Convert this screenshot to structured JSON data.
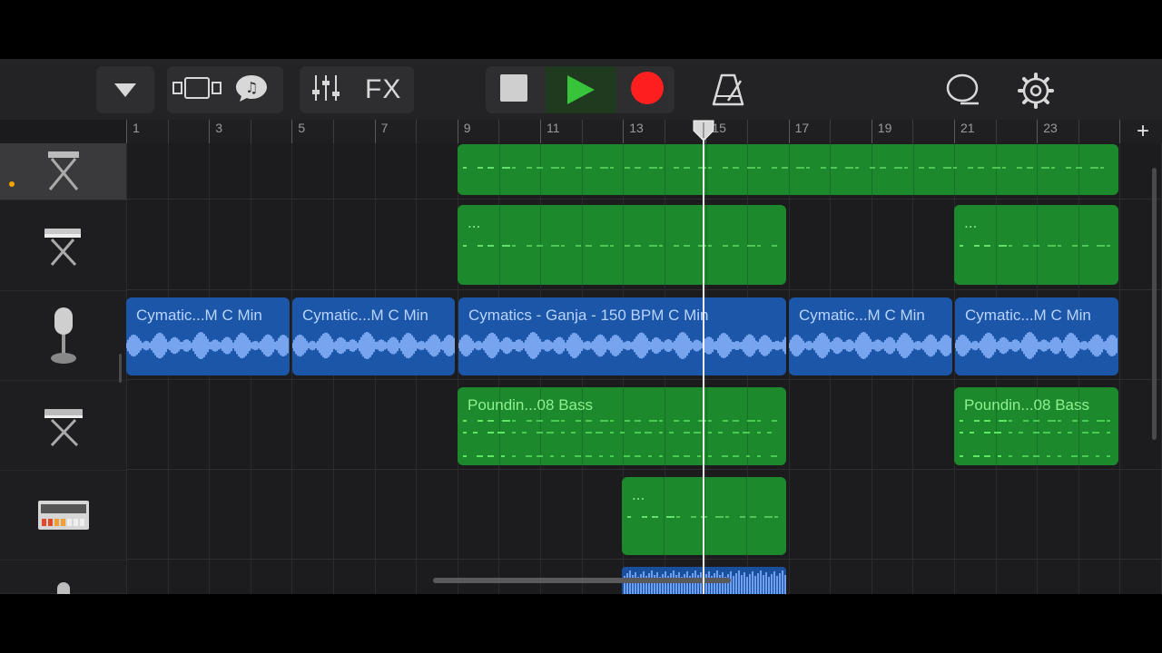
{
  "toolbar": {
    "fx_label": "FX",
    "buttons": [
      "browser-menu",
      "view-toggle",
      "loop-browser",
      "mixer",
      "fx",
      "stop",
      "play",
      "record",
      "metronome",
      "master-effects",
      "settings"
    ]
  },
  "ruler": {
    "bar_labels": [
      "1",
      "3",
      "5",
      "7",
      "9",
      "11",
      "13",
      "15",
      "17",
      "19",
      "21",
      "23"
    ],
    "add_label": "+"
  },
  "tracks": [
    {
      "instrument": "keyboard-stand-icon",
      "selected": true
    },
    {
      "instrument": "synth-keyboard-icon",
      "selected": false
    },
    {
      "instrument": "microphone-icon",
      "selected": false
    },
    {
      "instrument": "keyboard-stand-icon",
      "selected": false
    },
    {
      "instrument": "drum-machine-icon",
      "selected": false
    },
    {
      "instrument": "microphone-icon",
      "selected": false
    }
  ],
  "regions": {
    "t2_a": "...",
    "t2_b": "...",
    "t3_a": "Cymatic...M C Min",
    "t3_b": "Cymatic...M C Min",
    "t3_c": "Cymatics - Ganja - 150 BPM C Min",
    "t3_d": "Cymatic...M C Min",
    "t3_e": "Cymatic...M C Min",
    "t4_a": "Poundin...08 Bass",
    "t4_b": "Poundin...08 Bass",
    "t5_a": "..."
  },
  "colors": {
    "play": "#37c43a",
    "record": "#ff1f1f",
    "midi_region": "#1c8a2c",
    "audio_region": "#1b56a8"
  }
}
